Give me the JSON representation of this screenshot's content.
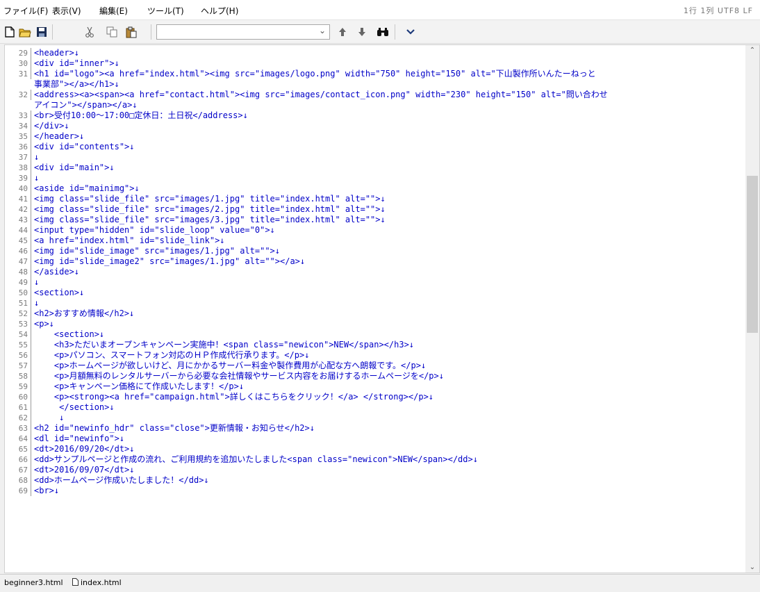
{
  "menu": {
    "file": "ファイル(F)",
    "view": "表示(V)",
    "edit": "編集(E)",
    "tools": "ツール(T)",
    "help": "ヘルプ(H)"
  },
  "status": {
    "position": "1行 1列",
    "encoding": "UTF8",
    "line_ending": "LF"
  },
  "search": {
    "value": "",
    "placeholder": ""
  },
  "icons": {
    "new": "new-file-icon",
    "open": "open-folder-icon",
    "save": "save-icon",
    "cut": "cut-icon",
    "copy": "copy-icon",
    "paste": "paste-icon",
    "up": "search-up-icon",
    "down": "search-down-icon",
    "find": "binoculars-icon",
    "more": "chevron-down-icon"
  },
  "colors": {
    "code": "#0000c8",
    "text": "#000000",
    "line_number": "#7a7a7a"
  },
  "editor": {
    "lines": [
      {
        "num": "29",
        "code": "<header>↓"
      },
      {
        "num": "30",
        "code": "<div id=\"inner\">↓"
      },
      {
        "num": "31",
        "code": "<h1 id=\"logo\"><a href=\"index.html\"><img src=\"images/logo.png\" width=\"750\" height=\"150\" alt=\"下山製作所いんたーねっと"
      },
      {
        "num": "",
        "code": "事業部\"></a></h1>↓"
      },
      {
        "num": "32",
        "code": "<address><a><span><a href=\"contact.html\"><img src=\"images/contact_icon.png\" width=\"230\" height=\"150\" alt=\"問い合わせ"
      },
      {
        "num": "",
        "code": "アイコン\"></span></a>↓"
      },
      {
        "num": "33",
        "code": "<br>受付10:00～17:00□定休日：土日祝</address>↓"
      },
      {
        "num": "34",
        "code": "</div>↓"
      },
      {
        "num": "35",
        "code": "</header>↓"
      },
      {
        "num": "36",
        "code": "<div id=\"contents\">↓"
      },
      {
        "num": "37",
        "code": "↓"
      },
      {
        "num": "38",
        "code": "<div id=\"main\">↓"
      },
      {
        "num": "39",
        "code": "↓"
      },
      {
        "num": "40",
        "code": "<aside id=\"mainimg\">↓"
      },
      {
        "num": "41",
        "code": "<img class=\"slide_file\" src=\"images/1.jpg\" title=\"index.html\" alt=\"\">↓"
      },
      {
        "num": "42",
        "code": "<img class=\"slide_file\" src=\"images/2.jpg\" title=\"index.html\" alt=\"\">↓"
      },
      {
        "num": "43",
        "code": "<img class=\"slide_file\" src=\"images/3.jpg\" title=\"index.html\" alt=\"\">↓"
      },
      {
        "num": "44",
        "code": "<input type=\"hidden\" id=\"slide_loop\" value=\"0\">↓"
      },
      {
        "num": "45",
        "code": "<a href=\"index.html\" id=\"slide_link\">↓"
      },
      {
        "num": "46",
        "code": "<img id=\"slide_image\" src=\"images/1.jpg\" alt=\"\">↓"
      },
      {
        "num": "47",
        "code": "<img id=\"slide_image2\" src=\"images/1.jpg\" alt=\"\"></a>↓"
      },
      {
        "num": "48",
        "code": "</aside>↓"
      },
      {
        "num": "49",
        "code": "↓"
      },
      {
        "num": "50",
        "code": "<section>↓"
      },
      {
        "num": "51",
        "code": "↓"
      },
      {
        "num": "52",
        "code": "<h2>おすすめ情報</h2>↓"
      },
      {
        "num": "53",
        "code": "<p>↓"
      },
      {
        "num": "54",
        "code": "    <section>↓"
      },
      {
        "num": "55",
        "code": "    <h3>ただいまオープンキャンペーン実施中！<span class=\"newicon\">NEW</span></h3>↓"
      },
      {
        "num": "56",
        "code": "    <p>パソコン、スマートフォン対応のＨＰ作成代行承ります。</p>↓"
      },
      {
        "num": "57",
        "code": "    <p>ホームページが欲しいけど、月にかかるサーバー料金や製作費用が心配な方へ朗報です。</p>↓"
      },
      {
        "num": "58",
        "code": "    <p>月額無料のレンタルサーバーから必要な会社情報やサービス内容をお届けするホームページを</p>↓"
      },
      {
        "num": "59",
        "code": "    <p>キャンペーン価格にて作成いたします！</p>↓"
      },
      {
        "num": "60",
        "code": "    <p><strong><a href=\"campaign.html\">詳しくはこちらをクリック！</a> </strong></p>↓"
      },
      {
        "num": "61",
        "code": "     </section>↓"
      },
      {
        "num": "62",
        "code": "     ↓"
      },
      {
        "num": "63",
        "code": "<h2 id=\"newinfo_hdr\" class=\"close\">更新情報・お知らせ</h2>↓"
      },
      {
        "num": "64",
        "code": "<dl id=\"newinfo\">↓"
      },
      {
        "num": "65",
        "code": "<dt>2016/09/20</dt>↓"
      },
      {
        "num": "66",
        "code": "<dd>サンプルページと作成の流れ、ご利用規約を追加いたしました<span class=\"newicon\">NEW</span></dd>↓"
      },
      {
        "num": "67",
        "code": "<dt>2016/09/07</dt>↓"
      },
      {
        "num": "68",
        "code": "<dd>ホームページ作成いたしました！</dd>↓"
      },
      {
        "num": "69",
        "code": "<br>↓"
      }
    ]
  },
  "tabs": [
    {
      "label": "beginner3.html"
    },
    {
      "label": "index.html"
    }
  ]
}
